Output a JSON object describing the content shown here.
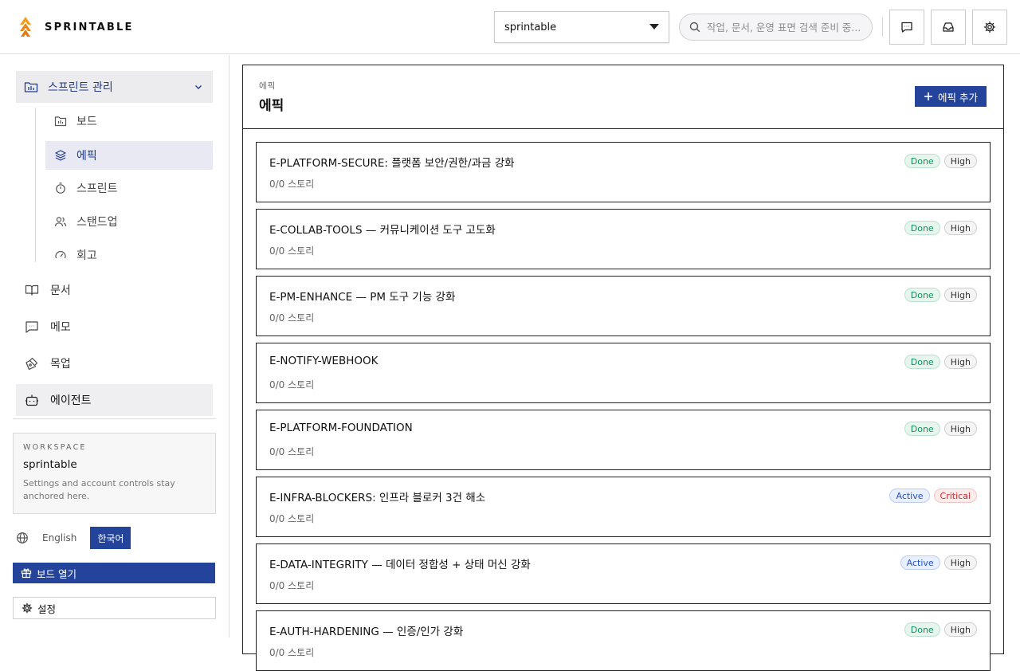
{
  "app": {
    "name": "SPRINTABLE"
  },
  "header": {
    "workspace_select": "sprintable",
    "search_placeholder": "작업, 문서, 운영 표면 검색 준비 중...",
    "icons": [
      "message-icon",
      "inbox-icon",
      "gear-icon"
    ]
  },
  "sidebar": {
    "group": {
      "label": "스프린트 관리",
      "expanded": true
    },
    "sub_items": [
      {
        "label": "보드",
        "icon": "board-icon"
      },
      {
        "label": "에픽",
        "icon": "layers-icon",
        "active": true
      },
      {
        "label": "스프린트",
        "icon": "stopwatch-icon"
      },
      {
        "label": "스탠드업",
        "icon": "users-icon"
      },
      {
        "label": "회고",
        "icon": "gauge-icon"
      }
    ],
    "items": [
      {
        "label": "문서",
        "icon": "book-icon"
      },
      {
        "label": "메모",
        "icon": "chat-icon"
      },
      {
        "label": "목업",
        "icon": "pen-tool-icon"
      },
      {
        "label": "에이전트",
        "icon": "bot-icon",
        "active": true
      }
    ],
    "workspace_card": {
      "kicker": "WORKSPACE",
      "name": "sprintable",
      "desc": "Settings and account controls stay anchored here."
    },
    "languages": {
      "english": "English",
      "korean": "한국어",
      "selected": "한국어"
    },
    "open_board": "보드 열기",
    "settings": "설정"
  },
  "main": {
    "breadcrumb": "에픽",
    "title": "에픽",
    "add_button": "에픽 추가",
    "epics": [
      {
        "title": "E-PLATFORM-SECURE: 플랫폼 보안/권한/과금 강화",
        "stories": "0/0 스토리",
        "status": "Done",
        "priority": "High"
      },
      {
        "title": "E-COLLAB-TOOLS — 커뮤니케이션 도구 고도화",
        "stories": "0/0 스토리",
        "status": "Done",
        "priority": "High"
      },
      {
        "title": "E-PM-ENHANCE — PM 도구 기능 강화",
        "stories": "0/0 스토리",
        "status": "Done",
        "priority": "High"
      },
      {
        "title": "E-NOTIFY-WEBHOOK",
        "stories": "0/0 스토리",
        "status": "Done",
        "priority": "High"
      },
      {
        "title": "E-PLATFORM-FOUNDATION",
        "stories": "0/0 스토리",
        "status": "Done",
        "priority": "High"
      },
      {
        "title": "E-INFRA-BLOCKERS: 인프라 블로커 3건 해소",
        "stories": "0/0 스토리",
        "status": "Active",
        "priority": "Critical"
      },
      {
        "title": "E-DATA-INTEGRITY — 데이터 정합성 + 상태 머신 강화",
        "stories": "0/0 스토리",
        "status": "Active",
        "priority": "High"
      },
      {
        "title": "E-AUTH-HARDENING — 인증/인가 강화",
        "stories": "0/0 스토리",
        "status": "Done",
        "priority": "High"
      }
    ]
  },
  "colors": {
    "accent": "#24449b",
    "done": "#15905a",
    "active": "#2553c8",
    "critical": "#c92a2a"
  }
}
